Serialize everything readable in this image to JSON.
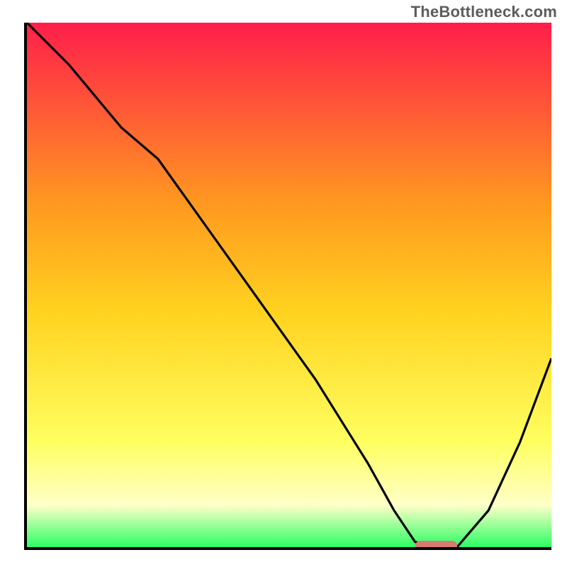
{
  "watermark": "TheBottleneck.com",
  "colors": {
    "gradient_top": "#ff1e4b",
    "gradient_upper_mid": "#ff9a1f",
    "gradient_mid": "#ffd21f",
    "gradient_lower_mid": "#feff60",
    "gradient_pale": "#ffffc8",
    "gradient_bottom": "#2bff64",
    "curve": "#000000",
    "marker": "#d87a74",
    "axis": "#000000"
  },
  "chart_data": {
    "type": "line",
    "title": "",
    "xlabel": "",
    "ylabel": "",
    "xlim": [
      0,
      100
    ],
    "ylim": [
      0,
      100
    ],
    "grid": false,
    "legend": false,
    "series": [
      {
        "name": "bottleneck-curve",
        "x": [
          0,
          8,
          18,
          25,
          35,
          45,
          55,
          65,
          70,
          74,
          78,
          82,
          88,
          94,
          100
        ],
        "y": [
          100,
          92,
          80,
          74,
          60,
          46,
          32,
          16,
          7,
          1,
          0,
          0,
          7,
          20,
          36
        ]
      }
    ],
    "annotations": [
      {
        "name": "optimal-range-marker",
        "x_start": 74,
        "x_end": 82,
        "y": 0,
        "color": "#d87a74"
      }
    ],
    "notes": "Background is a vertical red→orange→yellow→pale→green gradient. Black curve descends from top-left, reaches a flat minimum around x≈74–82 where a small rounded salmon marker sits on the x-axis, then rises toward the right edge."
  }
}
